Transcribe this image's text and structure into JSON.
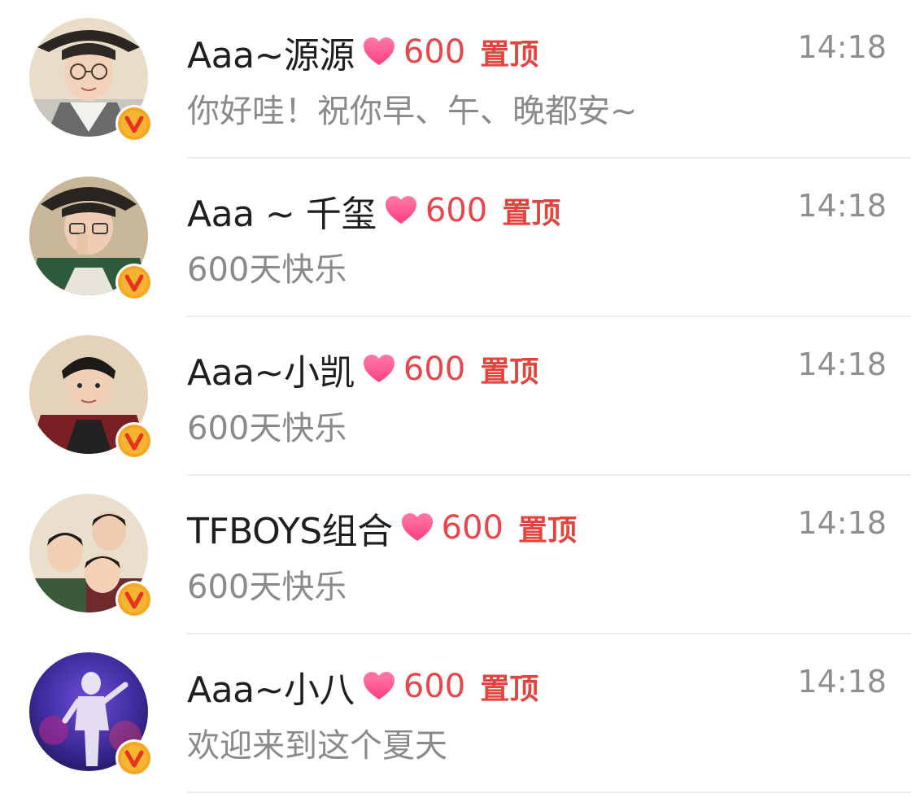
{
  "conversations": [
    {
      "name": "Aaa~源源",
      "badge_count": "600",
      "pinned_label": "置顶",
      "time": "14:18",
      "preview": "你好哇！祝你早、午、晚都安~",
      "verified": true
    },
    {
      "name": "Aaa ~ 千玺",
      "badge_count": "600",
      "pinned_label": "置顶",
      "time": "14:18",
      "preview": "600天快乐",
      "verified": true
    },
    {
      "name": "Aaa~小凯",
      "badge_count": "600",
      "pinned_label": "置顶",
      "time": "14:18",
      "preview": "600天快乐",
      "verified": true
    },
    {
      "name": "TFBOYS组合",
      "badge_count": "600",
      "pinned_label": "置顶",
      "time": "14:18",
      "preview": "600天快乐",
      "verified": true
    },
    {
      "name": "Aaa~小八",
      "badge_count": "600",
      "pinned_label": "置顶",
      "time": "14:18",
      "preview": "欢迎来到这个夏天",
      "verified": true
    }
  ],
  "colors": {
    "accent_red": "#e8464a",
    "heart_pink": "#ff4f8b",
    "verified_orange": "#f5a623",
    "time_gray": "#8f8f8f",
    "preview_gray": "#8a8a8a"
  },
  "icons": {
    "heart": "heart-icon",
    "verified": "verified-badge-icon"
  }
}
